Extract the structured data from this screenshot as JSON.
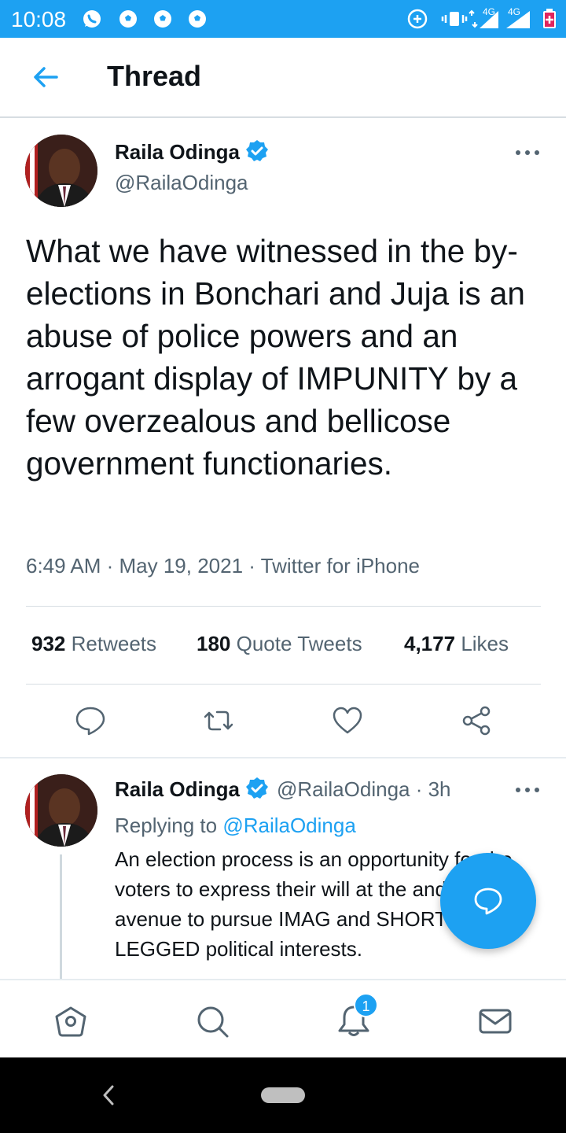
{
  "status_bar": {
    "time": "10:08",
    "network_label_1": "4G",
    "network_label_2": "4G",
    "background": "#1da1f2"
  },
  "header": {
    "title": "Thread"
  },
  "tweet": {
    "author_name": "Raila Odinga",
    "author_handle": "@RailaOdinga",
    "text": "What we have witnessed in the by-elections in Bonchari and Juja is an abuse of police powers and an arrogant display of IMPUNITY by a few overzealous and bellicose government functionaries.",
    "meta": "6:49 AM · May 19, 2021 · Twitter for iPhone",
    "retweets_count": "932",
    "retweets_label": "Retweets",
    "quotes_count": "180",
    "quotes_label": "Quote Tweets",
    "likes_count": "4,177",
    "likes_label": "Likes"
  },
  "reply": {
    "author_name": "Raila Odinga",
    "author_handle_time": "@RailaOdinga · 3h",
    "replying_to_prefix": "Replying to",
    "replying_to_handle": "@RailaOdinga",
    "text": "An election process is an opportunity for the voters to express their will at the and not an avenue to pursue IMAG and SHORT-LEGGED political interests."
  },
  "bottom_nav": {
    "notifications_badge": "1"
  },
  "icons": {
    "back": "arrow-left-icon",
    "more": "more-horizontal-icon",
    "reply": "reply-bubble-icon",
    "retweet": "retweet-icon",
    "like": "heart-icon",
    "share": "share-icon",
    "compose": "compose-reply-icon",
    "home": "home-icon",
    "search": "search-icon",
    "notifications": "bell-icon",
    "messages": "mail-icon"
  },
  "colors": {
    "accent": "#1da1f2",
    "text": "#0f1419",
    "secondary_text": "#536471"
  }
}
